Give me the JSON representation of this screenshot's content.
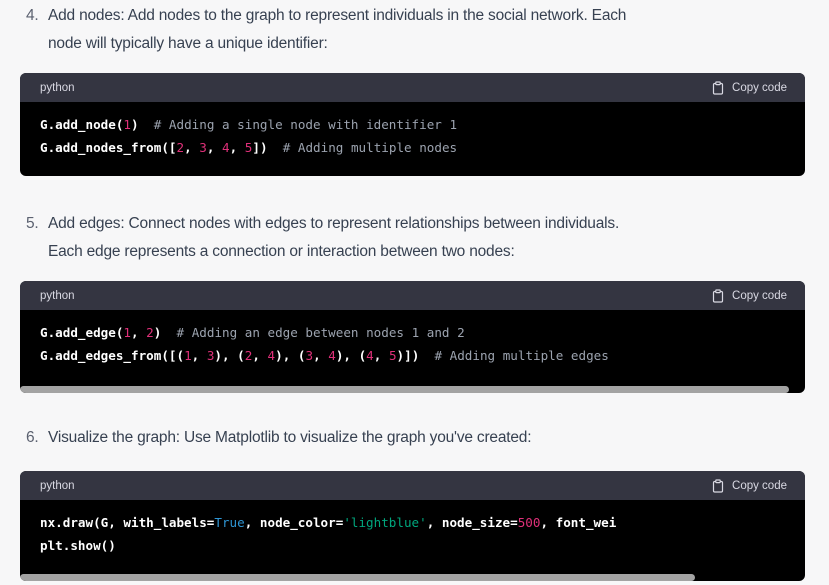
{
  "steps": [
    {
      "number": "4.",
      "line1": "Add nodes: Add nodes to the graph to represent individuals in the social network. Each",
      "line2": "node will typically have a unique identifier:"
    },
    {
      "number": "5.",
      "line1": "Add edges: Connect nodes with edges to represent relationships between individuals.",
      "line2": "Each edge represents a connection or interaction between two nodes:"
    },
    {
      "number": "6.",
      "line1": "Visualize the graph: Use Matplotlib to visualize the graph you've created:"
    }
  ],
  "code_blocks": [
    {
      "language": "python",
      "copy_label": "Copy code",
      "lines": [
        [
          {
            "t": "G.add_node(",
            "k": "fn"
          },
          {
            "t": "1",
            "k": "n"
          },
          {
            "t": ")",
            "k": "fn"
          },
          {
            "t": "  ",
            "k": "p"
          },
          {
            "t": "# Adding a single node with identifier 1",
            "k": "c"
          }
        ],
        [
          {
            "t": "G.add_nodes_from([",
            "k": "fn"
          },
          {
            "t": "2",
            "k": "n"
          },
          {
            "t": ", ",
            "k": "fn"
          },
          {
            "t": "3",
            "k": "n"
          },
          {
            "t": ", ",
            "k": "fn"
          },
          {
            "t": "4",
            "k": "n"
          },
          {
            "t": ", ",
            "k": "fn"
          },
          {
            "t": "5",
            "k": "n"
          },
          {
            "t": "])",
            "k": "fn"
          },
          {
            "t": "  ",
            "k": "p"
          },
          {
            "t": "# Adding multiple nodes",
            "k": "c"
          }
        ]
      ]
    },
    {
      "language": "python",
      "copy_label": "Copy code",
      "lines": [
        [
          {
            "t": "G.add_edge(",
            "k": "fn"
          },
          {
            "t": "1",
            "k": "n"
          },
          {
            "t": ", ",
            "k": "fn"
          },
          {
            "t": "2",
            "k": "n"
          },
          {
            "t": ")",
            "k": "fn"
          },
          {
            "t": "  ",
            "k": "p"
          },
          {
            "t": "# Adding an edge between nodes 1 and 2",
            "k": "c"
          }
        ],
        [
          {
            "t": "G.add_edges_from([(",
            "k": "fn"
          },
          {
            "t": "1",
            "k": "n"
          },
          {
            "t": ", ",
            "k": "fn"
          },
          {
            "t": "3",
            "k": "n"
          },
          {
            "t": "), (",
            "k": "fn"
          },
          {
            "t": "2",
            "k": "n"
          },
          {
            "t": ", ",
            "k": "fn"
          },
          {
            "t": "4",
            "k": "n"
          },
          {
            "t": "), (",
            "k": "fn"
          },
          {
            "t": "3",
            "k": "n"
          },
          {
            "t": ", ",
            "k": "fn"
          },
          {
            "t": "4",
            "k": "n"
          },
          {
            "t": "), (",
            "k": "fn"
          },
          {
            "t": "4",
            "k": "n"
          },
          {
            "t": ", ",
            "k": "fn"
          },
          {
            "t": "5",
            "k": "n"
          },
          {
            "t": ")])",
            "k": "fn"
          },
          {
            "t": "  ",
            "k": "p"
          },
          {
            "t": "# Adding multiple edges",
            "k": "c"
          }
        ]
      ],
      "scroll_fraction": 0.98
    },
    {
      "language": "python",
      "copy_label": "Copy code",
      "lines": [
        [
          {
            "t": "nx.draw(G, with_labels=",
            "k": "fn"
          },
          {
            "t": "True",
            "k": "kw"
          },
          {
            "t": ", node_color=",
            "k": "fn"
          },
          {
            "t": "'lightblue'",
            "k": "str"
          },
          {
            "t": ", node_size=",
            "k": "fn"
          },
          {
            "t": "500",
            "k": "n"
          },
          {
            "t": ", font_wei",
            "k": "fn"
          }
        ],
        [
          {
            "t": "plt.show()",
            "k": "fn"
          }
        ]
      ],
      "scroll_fraction": 0.86
    }
  ],
  "colors": {
    "page_background": "#f7f7f8",
    "code_background": "#000000",
    "code_header": "#343541",
    "number_literal": "#df3079",
    "comment": "#9ca3af",
    "keyword": "#2e95d3",
    "string": "#00a67d"
  },
  "icons": {
    "copy": "clipboard-icon"
  }
}
